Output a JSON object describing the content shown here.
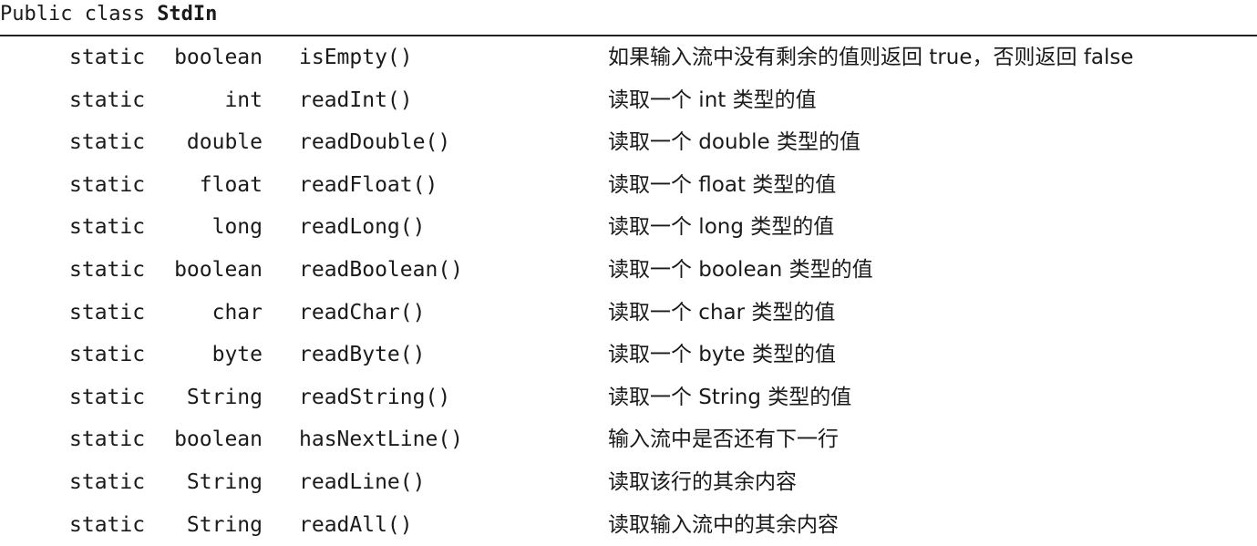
{
  "header": {
    "prefix": "Public class ",
    "class_name": "StdIn"
  },
  "rows": [
    {
      "modifier": "static",
      "type": "boolean",
      "method": "isEmpty()",
      "description": "如果输入流中没有剩余的值则返回 true，否则返回 false"
    },
    {
      "modifier": "static",
      "type": "int",
      "method": "readInt()",
      "description": "读取一个 int 类型的值"
    },
    {
      "modifier": "static",
      "type": "double",
      "method": "readDouble()",
      "description": "读取一个 double 类型的值"
    },
    {
      "modifier": "static",
      "type": "float",
      "method": "readFloat()",
      "description": "读取一个 float 类型的值"
    },
    {
      "modifier": "static",
      "type": "long",
      "method": "readLong()",
      "description": "读取一个 long 类型的值"
    },
    {
      "modifier": "static",
      "type": "boolean",
      "method": "readBoolean()",
      "description": "读取一个 boolean 类型的值"
    },
    {
      "modifier": "static",
      "type": "char",
      "method": "readChar()",
      "description": "读取一个 char 类型的值"
    },
    {
      "modifier": "static",
      "type": "byte",
      "method": "readByte()",
      "description": "读取一个 byte 类型的值"
    },
    {
      "modifier": "static",
      "type": "String",
      "method": "readString()",
      "description": "读取一个 String 类型的值"
    },
    {
      "modifier": "static",
      "type": "boolean",
      "method": "hasNextLine()",
      "description": "输入流中是否还有下一行"
    },
    {
      "modifier": "static",
      "type": "String",
      "method": "readLine()",
      "description": "读取该行的其余内容"
    },
    {
      "modifier": "static",
      "type": "String",
      "method": "readAll()",
      "description": "读取输入流中的其余内容"
    }
  ]
}
